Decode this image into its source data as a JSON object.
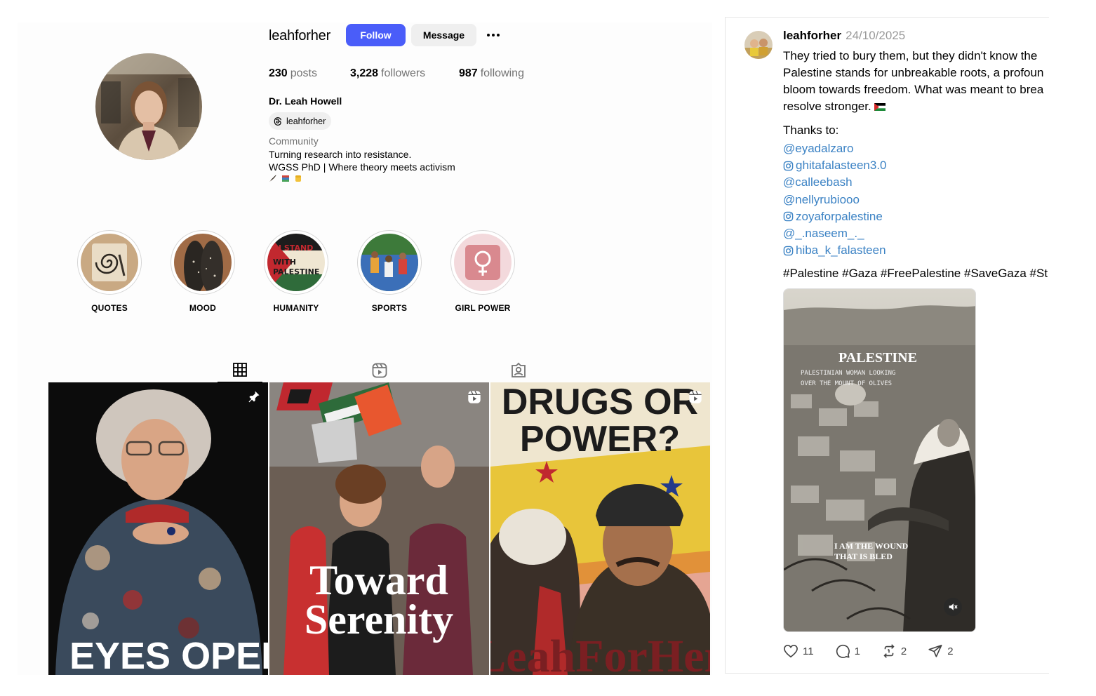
{
  "profile": {
    "username": "leahforher",
    "follow_label": "Follow",
    "message_label": "Message",
    "stats": {
      "posts_count": "230",
      "posts_label": "posts",
      "followers_count": "3,228",
      "followers_label": "followers",
      "following_count": "987",
      "following_label": "following"
    },
    "full_name": "Dr. Leah Howell",
    "threads_handle": "leahforher",
    "category": "Community",
    "bio_lines": [
      "Turning research into resistance.",
      "WGSS PhD | Where theory meets activism"
    ],
    "bio_emoji": [
      "feather-emoji",
      "books-emoji",
      "raised-fist-emoji"
    ],
    "accent_color": "#4a5df9"
  },
  "highlights": [
    {
      "label": "QUOTES"
    },
    {
      "label": "MOOD"
    },
    {
      "label": "HUMANITY",
      "image_text": [
        "I STAND",
        "WITH",
        "PALESTINE"
      ]
    },
    {
      "label": "SPORTS"
    },
    {
      "label": "GIRL POWER"
    }
  ],
  "tabs": [
    "posts-grid-icon",
    "reels-icon",
    "tagged-icon"
  ],
  "grid": [
    {
      "caption": "EYES OPEN,",
      "badge": "pin-icon"
    },
    {
      "caption_line1": "Toward",
      "caption_line2": "Serenity",
      "badge": "reel-icon"
    },
    {
      "caption_line1": "DRUGS OR",
      "caption_line2": "POWER?",
      "footer": "LeahForHer",
      "badge": "reel-icon"
    }
  ],
  "threads_post": {
    "username": "leahforher",
    "date": "24/10/2025",
    "body_lines": [
      "They tried to bury them, but they didn't know the",
      "Palestine stands for unbreakable roots, a profoun",
      "bloom towards freedom. What was meant to brea",
      "resolve stronger."
    ],
    "thanks_label": "Thanks to:",
    "mentions": [
      {
        "text": "@eyadalzaro",
        "instagram": false
      },
      {
        "text": "ghitafalasteen3.0",
        "instagram": true
      },
      {
        "text": "@calleebash",
        "instagram": false
      },
      {
        "text": "@nellyrubiooo",
        "instagram": false
      },
      {
        "text": "zoyaforpalestine",
        "instagram": true
      },
      {
        "text": "@_.naseem_._",
        "instagram": false
      },
      {
        "text": "hiba_k_falasteen",
        "instagram": true
      }
    ],
    "hashtags": "#Palestine #Gaza #FreePalestine #SaveGaza #St",
    "media": {
      "title": "PALESTINE",
      "subtitle_line1": "PALESTINIAN WOMAN LOOKING",
      "subtitle_line2": "OVER THE MOUNT OF OLIVES",
      "quote_line1": "I AM THE WOUND",
      "quote_line2": "THAT IS BLED"
    },
    "actions": {
      "likes": "11",
      "replies": "1",
      "reposts": "2",
      "shares": "2"
    },
    "link_color": "#3b82c4"
  }
}
